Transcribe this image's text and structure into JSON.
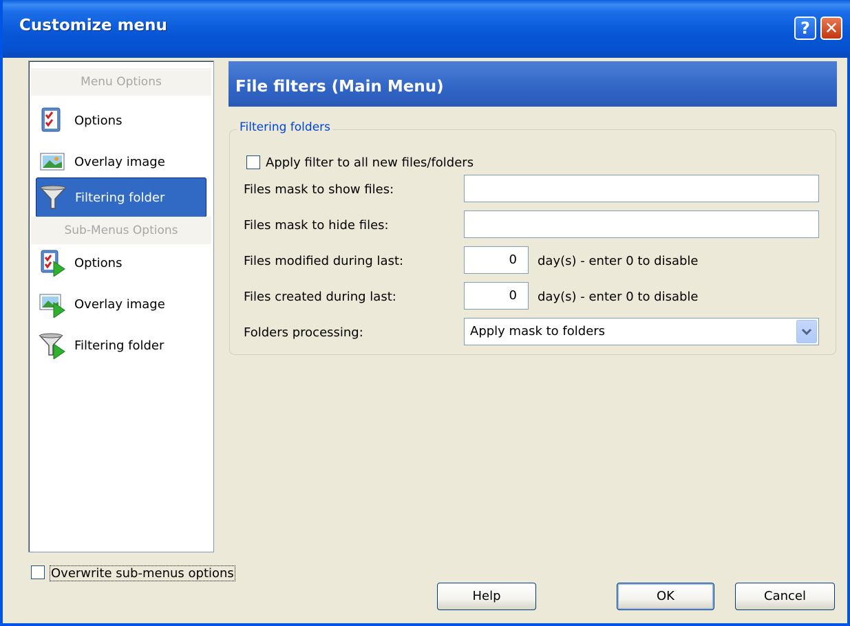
{
  "window": {
    "title": "Customize menu",
    "help_glyph": "?",
    "close_glyph": "✕"
  },
  "nav": {
    "header_menu": "Menu Options",
    "header_sub": "Sub-Menus Options",
    "menu_items": [
      {
        "label": "Options",
        "icon": "checklist-icon"
      },
      {
        "label": "Overlay image",
        "icon": "image-icon"
      },
      {
        "label": "Filtering folder",
        "icon": "funnel-icon"
      }
    ],
    "sub_items": [
      {
        "label": "Options",
        "icon": "checklist-arrow-icon"
      },
      {
        "label": "Overlay image",
        "icon": "image-arrow-icon"
      },
      {
        "label": "Filtering folder",
        "icon": "funnel-arrow-icon"
      }
    ],
    "selected": "Filtering folder"
  },
  "header": {
    "title": "File filters (Main Menu)"
  },
  "group": {
    "legend": "Filtering folders",
    "apply_filter_label": "Apply filter to all new files/folders",
    "show_mask_label": "Files mask to show files:",
    "show_mask_value": "",
    "hide_mask_label": "Files mask to hide files:",
    "hide_mask_value": "",
    "modified_label": "Files modified during last:",
    "modified_value": "0",
    "created_label": "Files created during last:",
    "created_value": "0",
    "days_hint": "day(s) - enter 0 to disable",
    "folders_label": "Folders processing:",
    "folders_value": "Apply mask to folders"
  },
  "footer": {
    "overwrite_label": "Overwrite sub-menus options",
    "help": "Help",
    "ok": "OK",
    "cancel": "Cancel"
  },
  "colors": {
    "titlebar": "#0858d8",
    "selection": "#316ac5",
    "legend": "#0046d5",
    "face": "#ece9d8"
  }
}
